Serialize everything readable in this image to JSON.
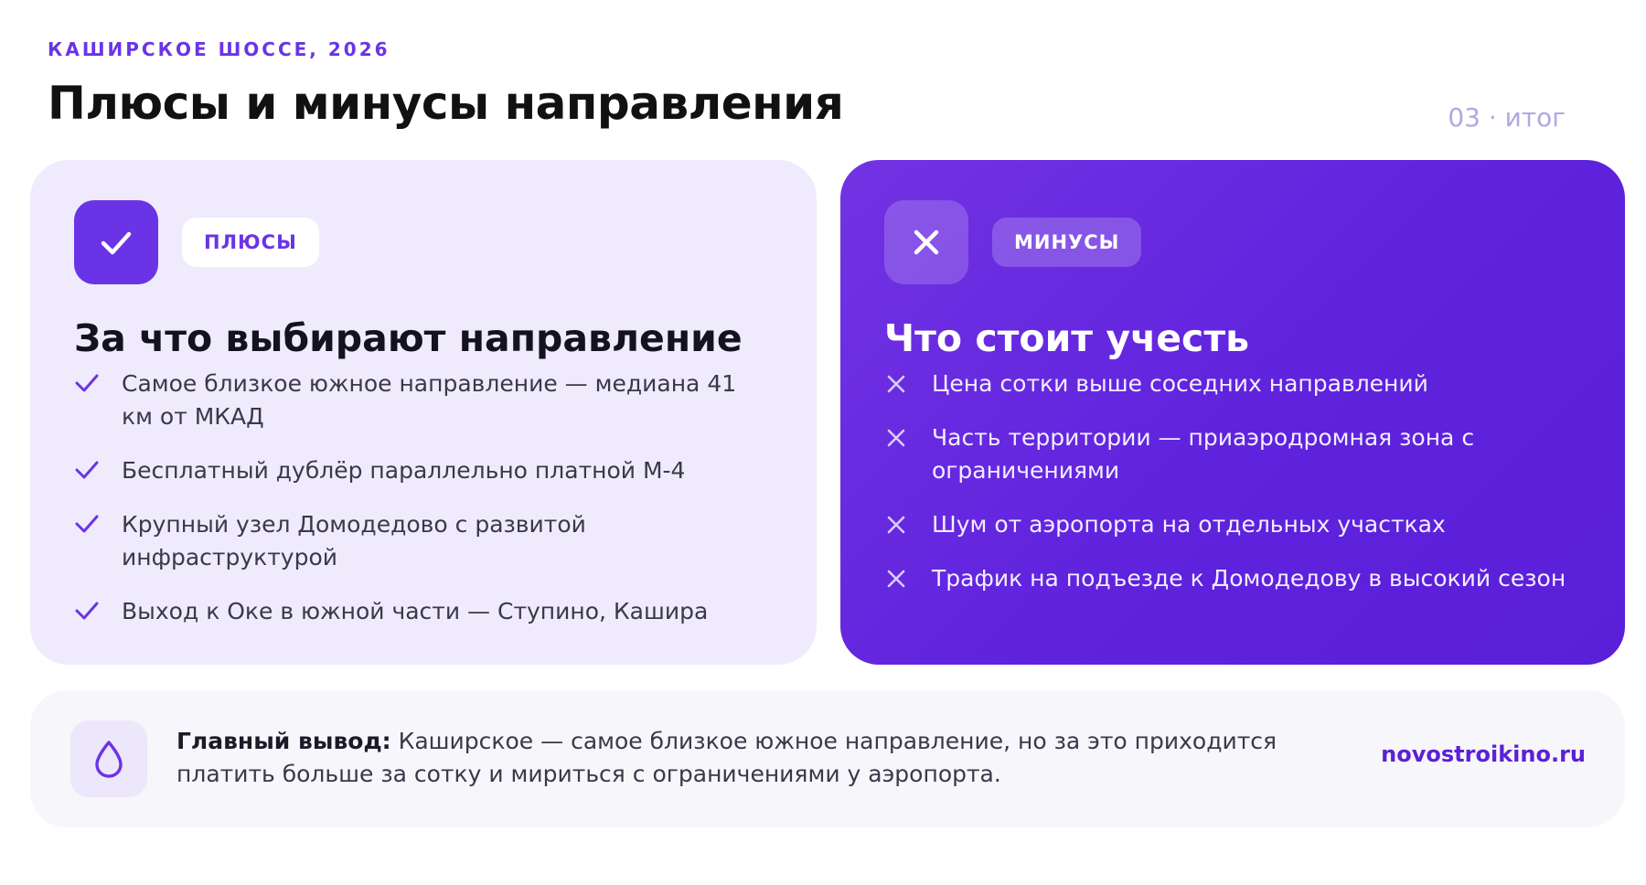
{
  "header": {
    "eyebrow": "КАШИРСКОЕ ШОССЕ, 2026",
    "title": "Плюсы и минусы направления",
    "counter": "03 · итог"
  },
  "pros": {
    "icon": "check-icon",
    "tag": "ПЛЮСЫ",
    "title": "За что выбирают направление",
    "items": [
      "Самое близкое южное направление — медиана 41 км от МКАД",
      "Бесплатный дублёр параллельно платной М-4",
      "Крупный узел Домодедово с развитой инфраструктурой",
      "Выход к Оке в южной части — Ступино, Кашира"
    ]
  },
  "cons": {
    "icon": "close-icon",
    "tag": "МИНУСЫ",
    "title": "Что стоит учесть",
    "items": [
      "Цена сотки выше соседних направлений",
      "Часть территории — приаэродромная зона с ограничениями",
      "Шум от аэропорта на отдельных участках",
      "Трафик на подъезде к Домодедову в высокий сезон"
    ]
  },
  "summary": {
    "icon": "drop-icon",
    "label": "Главный вывод:",
    "text": " Каширское — самое близкое южное направление, но за это приходится платить больше за сотку и мириться с ограничениями у аэропорта.",
    "link": "novostroikino.ru"
  },
  "colors": {
    "accent": "#6a34e6",
    "pros_bg": "#efebfc",
    "cons_bg": "#5f22dd",
    "muted": "#b3a7e0"
  }
}
